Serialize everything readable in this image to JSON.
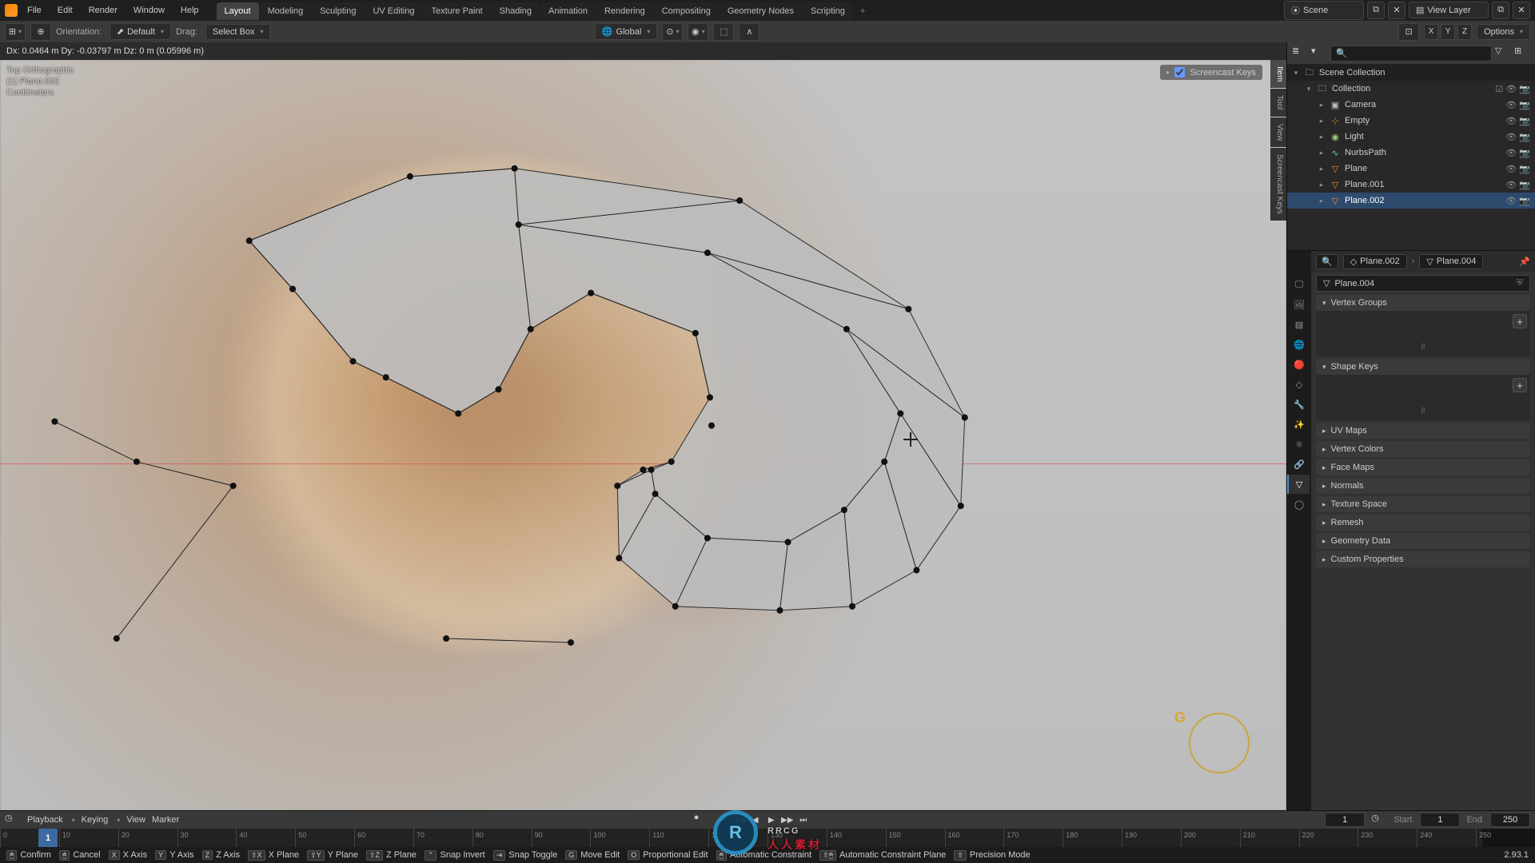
{
  "menu": {
    "file": "File",
    "edit": "Edit",
    "render": "Render",
    "window": "Window",
    "help": "Help"
  },
  "workspaces": [
    "Layout",
    "Modeling",
    "Sculpting",
    "UV Editing",
    "Texture Paint",
    "Shading",
    "Animation",
    "Rendering",
    "Compositing",
    "Geometry Nodes",
    "Scripting"
  ],
  "workspace_active": "Layout",
  "top_right": {
    "scene": "Scene",
    "viewlayer": "View Layer"
  },
  "viewhdr": {
    "orientation_label": "Orientation:",
    "orientation": "Default",
    "drag_label": "Drag:",
    "drag": "Select Box",
    "transform": "Global",
    "axes": [
      "X",
      "Y",
      "Z"
    ],
    "options": "Options"
  },
  "status_top": "Dx: 0.0464 m   Dy: -0.03797 m   Dz: 0 m (0.05996 m)",
  "viewport_info": {
    "line1": "Top Orthographic",
    "line2": "(1) Plane.002",
    "line3": "Centimeters"
  },
  "screencast": "Screencast Keys",
  "right_tabs": [
    "Item",
    "Tool",
    "View",
    "Screencast Keys"
  ],
  "nav_glyph": "G",
  "outliner": {
    "root": "Scene Collection",
    "collection": "Collection",
    "items": [
      {
        "name": "Camera",
        "type": "cam"
      },
      {
        "name": "Empty",
        "type": "empty"
      },
      {
        "name": "Light",
        "type": "light"
      },
      {
        "name": "NurbsPath",
        "type": "curve"
      },
      {
        "name": "Plane",
        "type": "mesh"
      },
      {
        "name": "Plane.001",
        "type": "mesh"
      },
      {
        "name": "Plane.002",
        "type": "mesh",
        "selected": true
      }
    ]
  },
  "props": {
    "crumb1": "Plane.002",
    "crumb2": "Plane.004",
    "name": "Plane.004",
    "panels": [
      "Vertex Groups",
      "Shape Keys",
      "UV Maps",
      "Vertex Colors",
      "Face Maps",
      "Normals",
      "Texture Space",
      "Remesh",
      "Geometry Data",
      "Custom Properties"
    ]
  },
  "timeline": {
    "menus": [
      "Playback",
      "Keying",
      "View",
      "Marker"
    ],
    "current": "1",
    "start_label": "Start",
    "start": "1",
    "end_label": "End",
    "end": "250",
    "ticks": [
      "0",
      "10",
      "20",
      "30",
      "40",
      "50",
      "60",
      "70",
      "80",
      "90",
      "100",
      "110",
      "120",
      "130",
      "140",
      "150",
      "160",
      "170",
      "180",
      "190",
      "200",
      "210",
      "220",
      "230",
      "240",
      "250"
    ],
    "playhead": "1"
  },
  "statusbar": {
    "items": [
      "Confirm",
      "Cancel",
      "X Axis",
      "Y Axis",
      "Z Axis",
      "X Plane",
      "Y Plane",
      "Z Plane",
      "Snap Invert",
      "Snap Toggle",
      "Move Edit",
      "Proportional Edit",
      "Automatic Constraint",
      "Automatic Constraint Plane",
      "Precision Mode"
    ],
    "version": "2.93.1"
  },
  "watermark": {
    "brand": "RRCG",
    "sub": "人人素材"
  }
}
